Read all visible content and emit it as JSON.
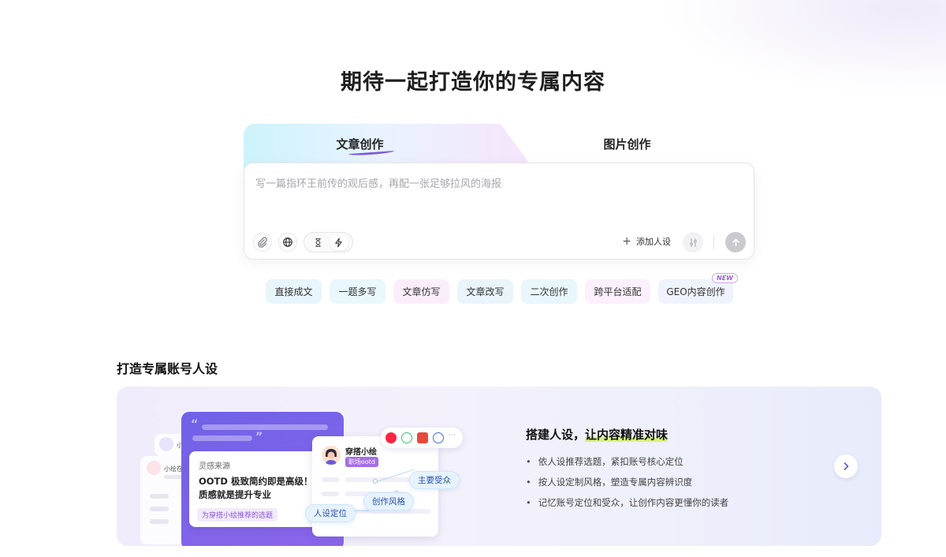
{
  "hero": {
    "title": "期待一起打造你的专属内容"
  },
  "tabs": [
    {
      "label": "文章创作",
      "active": true
    },
    {
      "label": "图片创作",
      "active": false
    }
  ],
  "composer": {
    "placeholder": "写一篇指环王前传的观后感，再配一张足够拉风的海报",
    "value": "",
    "add_persona_label": "添加人设"
  },
  "icons": {
    "attach": "paperclip-icon",
    "web": "globe-icon",
    "deep": "hourglass-icon",
    "fast": "lightning-icon",
    "tune": "sliders-icon",
    "send": "arrow-up-icon",
    "next": "chevron-right-icon"
  },
  "chips": [
    {
      "label": "直接成文"
    },
    {
      "label": "一题多写"
    },
    {
      "label": "文章仿写"
    },
    {
      "label": "文章改写"
    },
    {
      "label": "二次创作"
    },
    {
      "label": "跨平台适配"
    },
    {
      "label": "GEO内容创作",
      "badge": "NEW"
    }
  ],
  "section": {
    "title": "打造专属账号人设",
    "card": {
      "heading_prefix": "搭建人设，",
      "heading_highlight": "让内容精准对味",
      "bullets": [
        "依人设推荐选题，紧扣账号核心定位",
        "按人设定制风格，塑造专属内容辨识度",
        "记忆账号定位和受众，让创作内容更懂你的读者"
      ]
    },
    "illustration": {
      "ghost_names": [
        "小",
        "小绘在"
      ],
      "inspiration_label": "灵感来源",
      "inspiration_text_1": "OOTD 极致简约即是高级！折",
      "inspiration_text_2": "质感就是提升专业",
      "inspiration_tag": "为穿搭小绘推荐的选题",
      "profile_name": "穿搭小绘",
      "profile_tag": "职场ootd",
      "platform_more": "···",
      "bubbles": {
        "audience": "主要受众",
        "style": "创作风格",
        "position": "人设定位"
      }
    }
  },
  "colors": {
    "accent": "#7b5bdc",
    "purple_card": "#7463e8",
    "bubble_text": "#2a4ea8"
  }
}
